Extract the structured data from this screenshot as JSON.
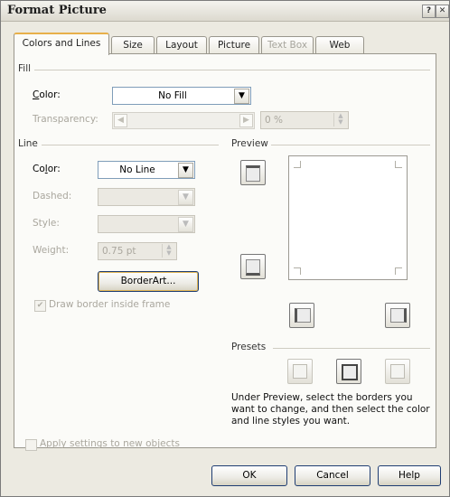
{
  "title": "Format Picture",
  "titlebar": {
    "help_glyph": "?",
    "close_glyph": "✕"
  },
  "tabs": [
    {
      "label": "Colors and Lines"
    },
    {
      "label": "Size"
    },
    {
      "label": "Layout"
    },
    {
      "label": "Picture"
    },
    {
      "label": "Text Box"
    },
    {
      "label": "Web"
    }
  ],
  "fill": {
    "group_label": "Fill",
    "color_label": "Color:",
    "color_value": "No Fill",
    "transparency_label": "Transparency:",
    "transparency_value": "0 %",
    "transparency_level": 0
  },
  "line": {
    "group_label": "Line",
    "color_label": "Color:",
    "color_value": "No Line",
    "dashed_label": "Dashed:",
    "style_label": "Style:",
    "weight_label": "Weight:",
    "weight_value": "0.75 pt",
    "borderart_label": "BorderArt...",
    "draw_inside_label": "Draw border inside frame",
    "draw_inside_checked": true
  },
  "preview": {
    "group_label": "Preview"
  },
  "presets": {
    "group_label": "Presets",
    "description": "Under Preview, select the borders you want to change, and then select the color and line styles you want."
  },
  "apply_settings_label": "Apply settings to new objects",
  "apply_settings_checked": false,
  "buttons": {
    "ok": "OK",
    "cancel": "Cancel",
    "help": "Help"
  },
  "colors": {
    "accent_tab": "#e8b04a",
    "button_border": "#1f3d72",
    "disabled_text": "#aaa79e"
  }
}
